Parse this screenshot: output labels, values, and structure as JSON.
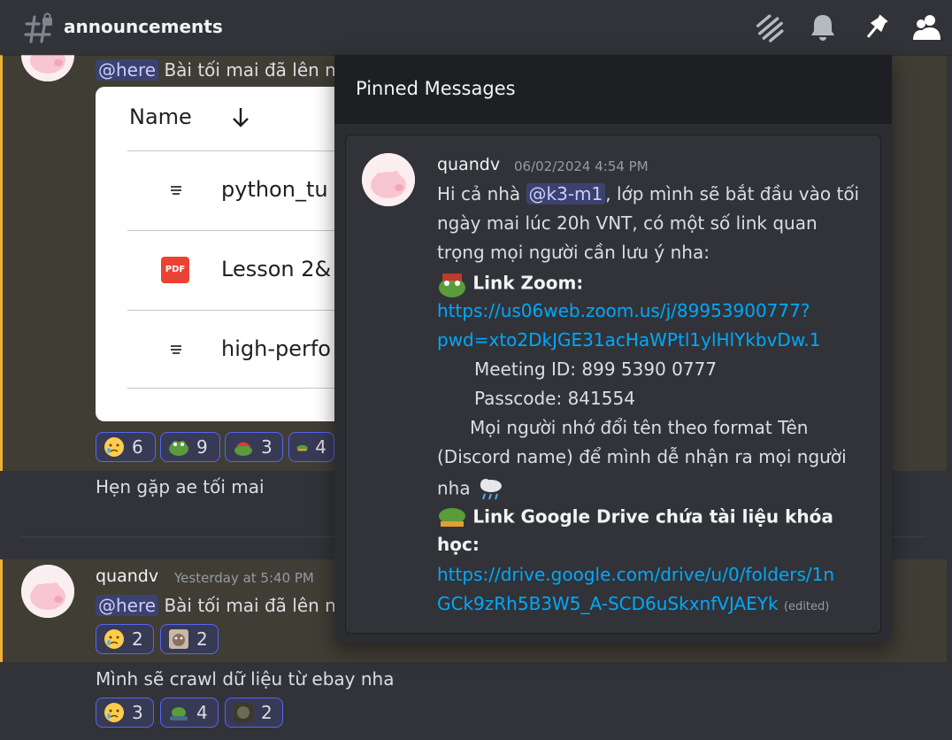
{
  "header": {
    "channel_name": "announcements",
    "icons": [
      "hash-lock-icon",
      "threads-icon",
      "bell-icon",
      "pin-icon",
      "members-icon"
    ]
  },
  "chat": {
    "msg1": {
      "text": "Bài tối mai đã lên n",
      "mention": "@here",
      "image_rows": {
        "header_name": "Name",
        "row1": "python_tu",
        "row2": "Lesson 2&",
        "row3": "high-perfo",
        "pdf_badge": "PDF"
      },
      "reactions": [
        {
          "emoji": "crying-face",
          "count": "6"
        },
        {
          "emoji": "pepe-frog",
          "count": "9"
        },
        {
          "emoji": "frog-with-hat",
          "count": "3"
        },
        {
          "emoji": "pepe-running",
          "count": "4"
        }
      ],
      "followup_text": "Hẹn gặp ae tối mai"
    },
    "msg2": {
      "username": "quandv",
      "timestamp": "Yesterday at 5:40 PM",
      "mention": "@here",
      "text": "Bài tối mai đã lên n",
      "reactions": [
        {
          "emoji": "crying-face",
          "count": "2"
        },
        {
          "emoji": "cat-meme",
          "count": "2"
        }
      ],
      "followup_text": "Mình sẽ crawl dữ liệu từ ebay nha",
      "followup_reactions": [
        {
          "emoji": "crying-face",
          "count": "3"
        },
        {
          "emoji": "frog-tank",
          "count": "4"
        },
        {
          "emoji": "dark-meme",
          "count": "2"
        }
      ]
    }
  },
  "pinned": {
    "title": "Pinned Messages",
    "message": {
      "username": "quandv",
      "timestamp": "06/02/2024 4:54 PM",
      "line1_pre": "Hi cả nhà ",
      "line1_mention": "@k3-m1",
      "line1_post": ", lớp mình sẽ bắt đầu vào tối",
      "line2": "ngày mai lúc 20h VNT, có một số link quan",
      "line3": "trọng mọi người cần lưu ý nha:",
      "zoom_label": "Link Zoom:",
      "zoom_link_1": "https://us06web.zoom.us/j/89953900777?",
      "zoom_link_2": "pwd=xto2DkJGE31acHaWPtl1ylHlYkbvDw.1",
      "meeting_id": "Meeting ID: 899 5390 0777",
      "passcode": "Passcode: 841554",
      "note_1": "Mọi người nhớ đổi tên theo format Tên",
      "note_2": "(Discord name) để mình dễ nhận ra mọi người",
      "note_3": "nha",
      "drive_label_1": "Link Google Drive chứa tài liệu khóa",
      "drive_label_2": "học:",
      "drive_link_1": "https://drive.google.com/drive/u/0/folders/1n",
      "drive_link_2": "GCk9zRh5B3W5_A-SCD6uSkxnfVJAEYk",
      "edited": "(edited)"
    }
  },
  "colors": {
    "background": "#313338",
    "mention_highlight": "#403d35",
    "mention_bar": "#f0b132",
    "link": "#00a8fc",
    "reaction_border": "#5865f2"
  }
}
